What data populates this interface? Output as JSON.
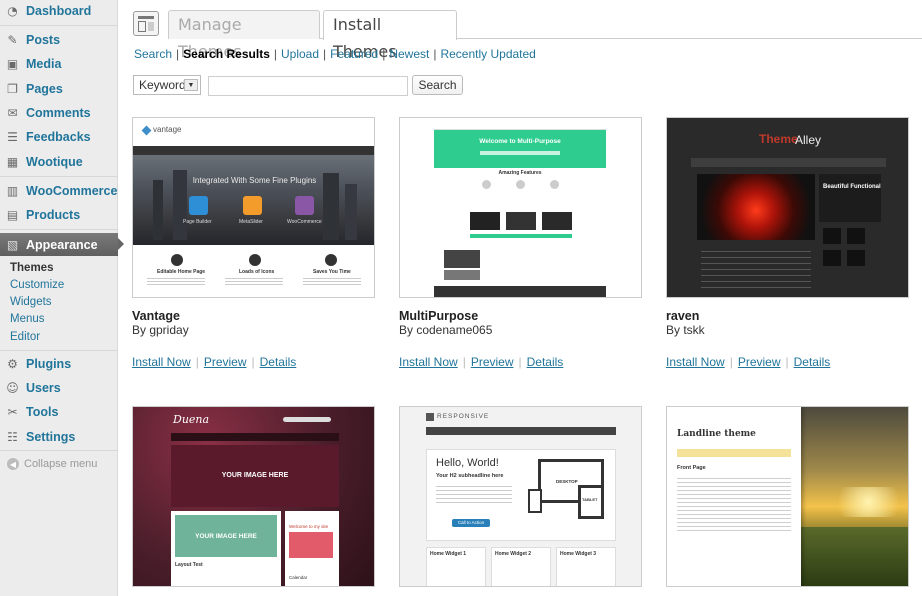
{
  "sidebar": {
    "items": [
      {
        "label": "Dashboard",
        "icon": "dashboard-icon"
      },
      {
        "label": "Posts",
        "icon": "pushpin-icon"
      },
      {
        "label": "Media",
        "icon": "media-icon"
      },
      {
        "label": "Pages",
        "icon": "pages-icon"
      },
      {
        "label": "Comments",
        "icon": "comment-icon"
      },
      {
        "label": "Feedbacks",
        "icon": "feedback-icon"
      },
      {
        "label": "Wootique",
        "icon": "woo-icon"
      },
      {
        "label": "WooCommerce",
        "icon": "woocommerce-icon"
      },
      {
        "label": "Products",
        "icon": "products-icon"
      },
      {
        "label": "Appearance",
        "icon": "appearance-icon"
      },
      {
        "label": "Plugins",
        "icon": "plugin-icon"
      },
      {
        "label": "Users",
        "icon": "users-icon"
      },
      {
        "label": "Tools",
        "icon": "tools-icon"
      },
      {
        "label": "Settings",
        "icon": "settings-icon"
      }
    ],
    "submenu": [
      "Themes",
      "Customize",
      "Widgets",
      "Menus",
      "Editor"
    ],
    "collapse_label": "Collapse menu"
  },
  "tabs": {
    "manage": "Manage Themes",
    "install": "Install Themes"
  },
  "subnav": {
    "items": [
      "Search",
      "Search Results",
      "Upload",
      "Featured",
      "Newest",
      "Recently Updated"
    ],
    "separator": "|"
  },
  "search": {
    "type_selected": "Keyword",
    "query": "",
    "button": "Search"
  },
  "themes": [
    {
      "name": "Vantage",
      "author": "By gpriday",
      "install": "Install Now",
      "preview": "Preview",
      "details": "Details",
      "shot": {
        "logo": "vantage",
        "headline": "Integrated With Some Fine Plugins",
        "plugins": [
          "Page Builder",
          "MetaSlider",
          "WooCommerce"
        ],
        "features": [
          "Editable Home Page",
          "Loads of Icons",
          "Saves You Time"
        ]
      }
    },
    {
      "name": "MultiPurpose",
      "author": "By codename065",
      "install": "Install Now",
      "preview": "Preview",
      "details": "Details",
      "shot": {
        "headline": "Welcome to Multi-Purpose",
        "section": "Amazing Features"
      }
    },
    {
      "name": "raven",
      "author": "By tskk",
      "install": "Install Now",
      "preview": "Preview",
      "details": "Details",
      "shot": {
        "logo_a": "Theme",
        "logo_b": "Alley",
        "side_title": "Beautiful Functional"
      }
    },
    {
      "name": "Duena",
      "author": "",
      "install": "",
      "preview": "",
      "details": "",
      "shot": {
        "logo": "Duena",
        "placeholder_a": "YOUR IMAGE HERE",
        "placeholder_b": "YOUR IMAGE HERE",
        "widget_title": "Welcome to my site",
        "post_title": "Layout Test",
        "calendar": "Calendar"
      }
    },
    {
      "name": "Responsive",
      "author": "",
      "install": "",
      "preview": "",
      "details": "",
      "shot": {
        "logo": "RESPONSIVE",
        "hello": "Hello, World!",
        "sub": "Your H2 subheadline here",
        "cta": "Call to Action",
        "desktop": "DESKTOP",
        "tablet": "TABLET",
        "widgets": [
          "Home Widget 1",
          "Home Widget 2",
          "Home Widget 3"
        ]
      }
    },
    {
      "name": "Landline",
      "author": "",
      "install": "",
      "preview": "",
      "details": "",
      "shot": {
        "logo": "Landline theme",
        "section": "Front Page"
      }
    }
  ],
  "colors": {
    "link": "#21759b",
    "sidebar_bg": "#ececec",
    "appearance_bg": "#6b6b6b"
  }
}
